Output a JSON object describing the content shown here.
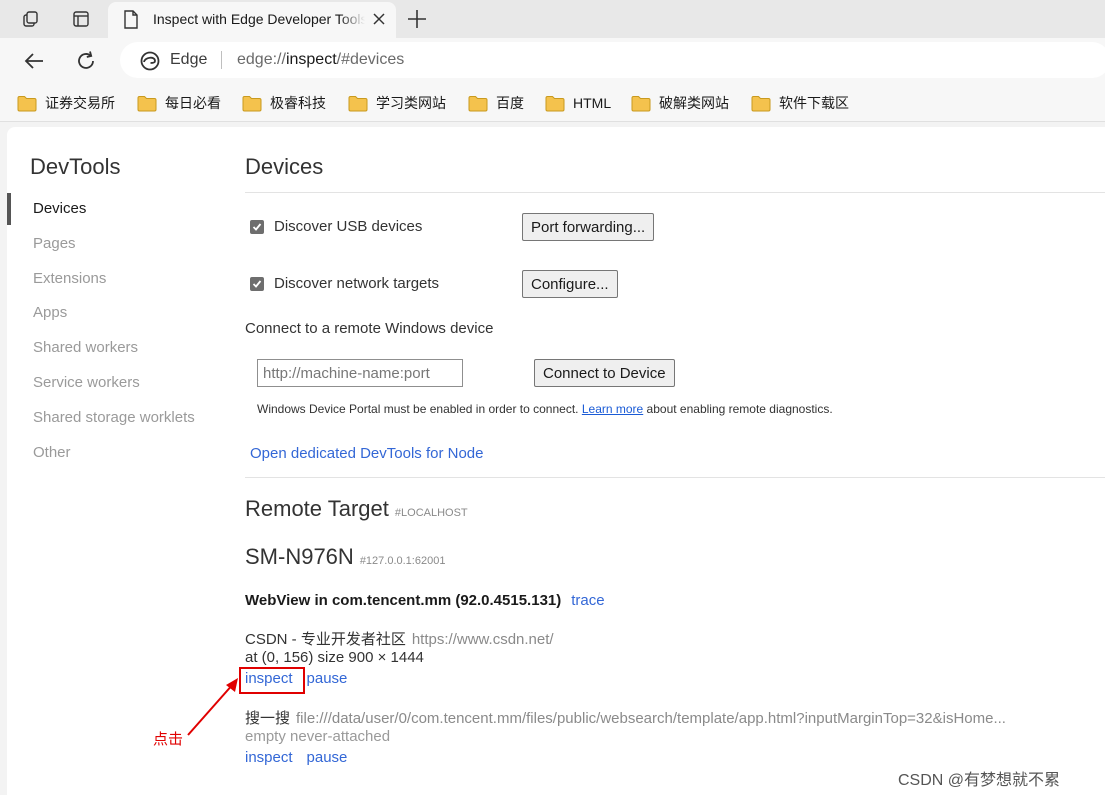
{
  "browser": {
    "tab_title": "Inspect with Edge Developer Tools",
    "omnibox_label": "Edge",
    "url_prefix": "edge://",
    "url_host": "inspect",
    "url_suffix": "/#devices"
  },
  "bookmarks": [
    "证券交易所",
    "每日必看",
    "极睿科技",
    "学习类网站",
    "百度",
    "HTML",
    "破解类网站",
    "软件下载区"
  ],
  "sidebar": {
    "title": "DevTools",
    "items": [
      "Devices",
      "Pages",
      "Extensions",
      "Apps",
      "Shared workers",
      "Service workers",
      "Shared storage worklets",
      "Other"
    ]
  },
  "devices": {
    "heading": "Devices",
    "discover_usb": "Discover USB devices",
    "port_forwarding": "Port forwarding...",
    "discover_network": "Discover network targets",
    "configure": "Configure...",
    "remote_windows_label": "Connect to a remote Windows device",
    "machine_placeholder": "http://machine-name:port",
    "connect_button": "Connect to Device",
    "portal_note_before": "Windows Device Portal must be enabled in order to connect. ",
    "portal_note_link": "Learn more",
    "portal_note_after": " about enabling remote diagnostics.",
    "node_link": "Open dedicated DevTools for Node"
  },
  "remote": {
    "heading": "Remote Target",
    "heading_tag": "#LOCALHOST",
    "device_name": "SM-N976N",
    "device_addr": "#127.0.0.1:62001",
    "browser_name": "WebView in com.tencent.mm (92.0.4515.131)",
    "trace_link": "trace",
    "targets": [
      {
        "title": "CSDN - 专业开发者社区",
        "url": "https://www.csdn.net/",
        "meta": "at (0, 156)  size 900 × 1444",
        "inspect": "inspect",
        "pause": "pause"
      },
      {
        "title": "搜一搜",
        "url": "file:///data/user/0/com.tencent.mm/files/public/websearch/template/app.html?inputMarginTop=32&isHome...",
        "meta": "empty never-attached",
        "inspect": "inspect",
        "pause": "pause"
      }
    ]
  },
  "annotation": {
    "click_label": "点击",
    "highlight_color": "#e00000"
  },
  "watermark": "CSDN @有梦想就不累"
}
